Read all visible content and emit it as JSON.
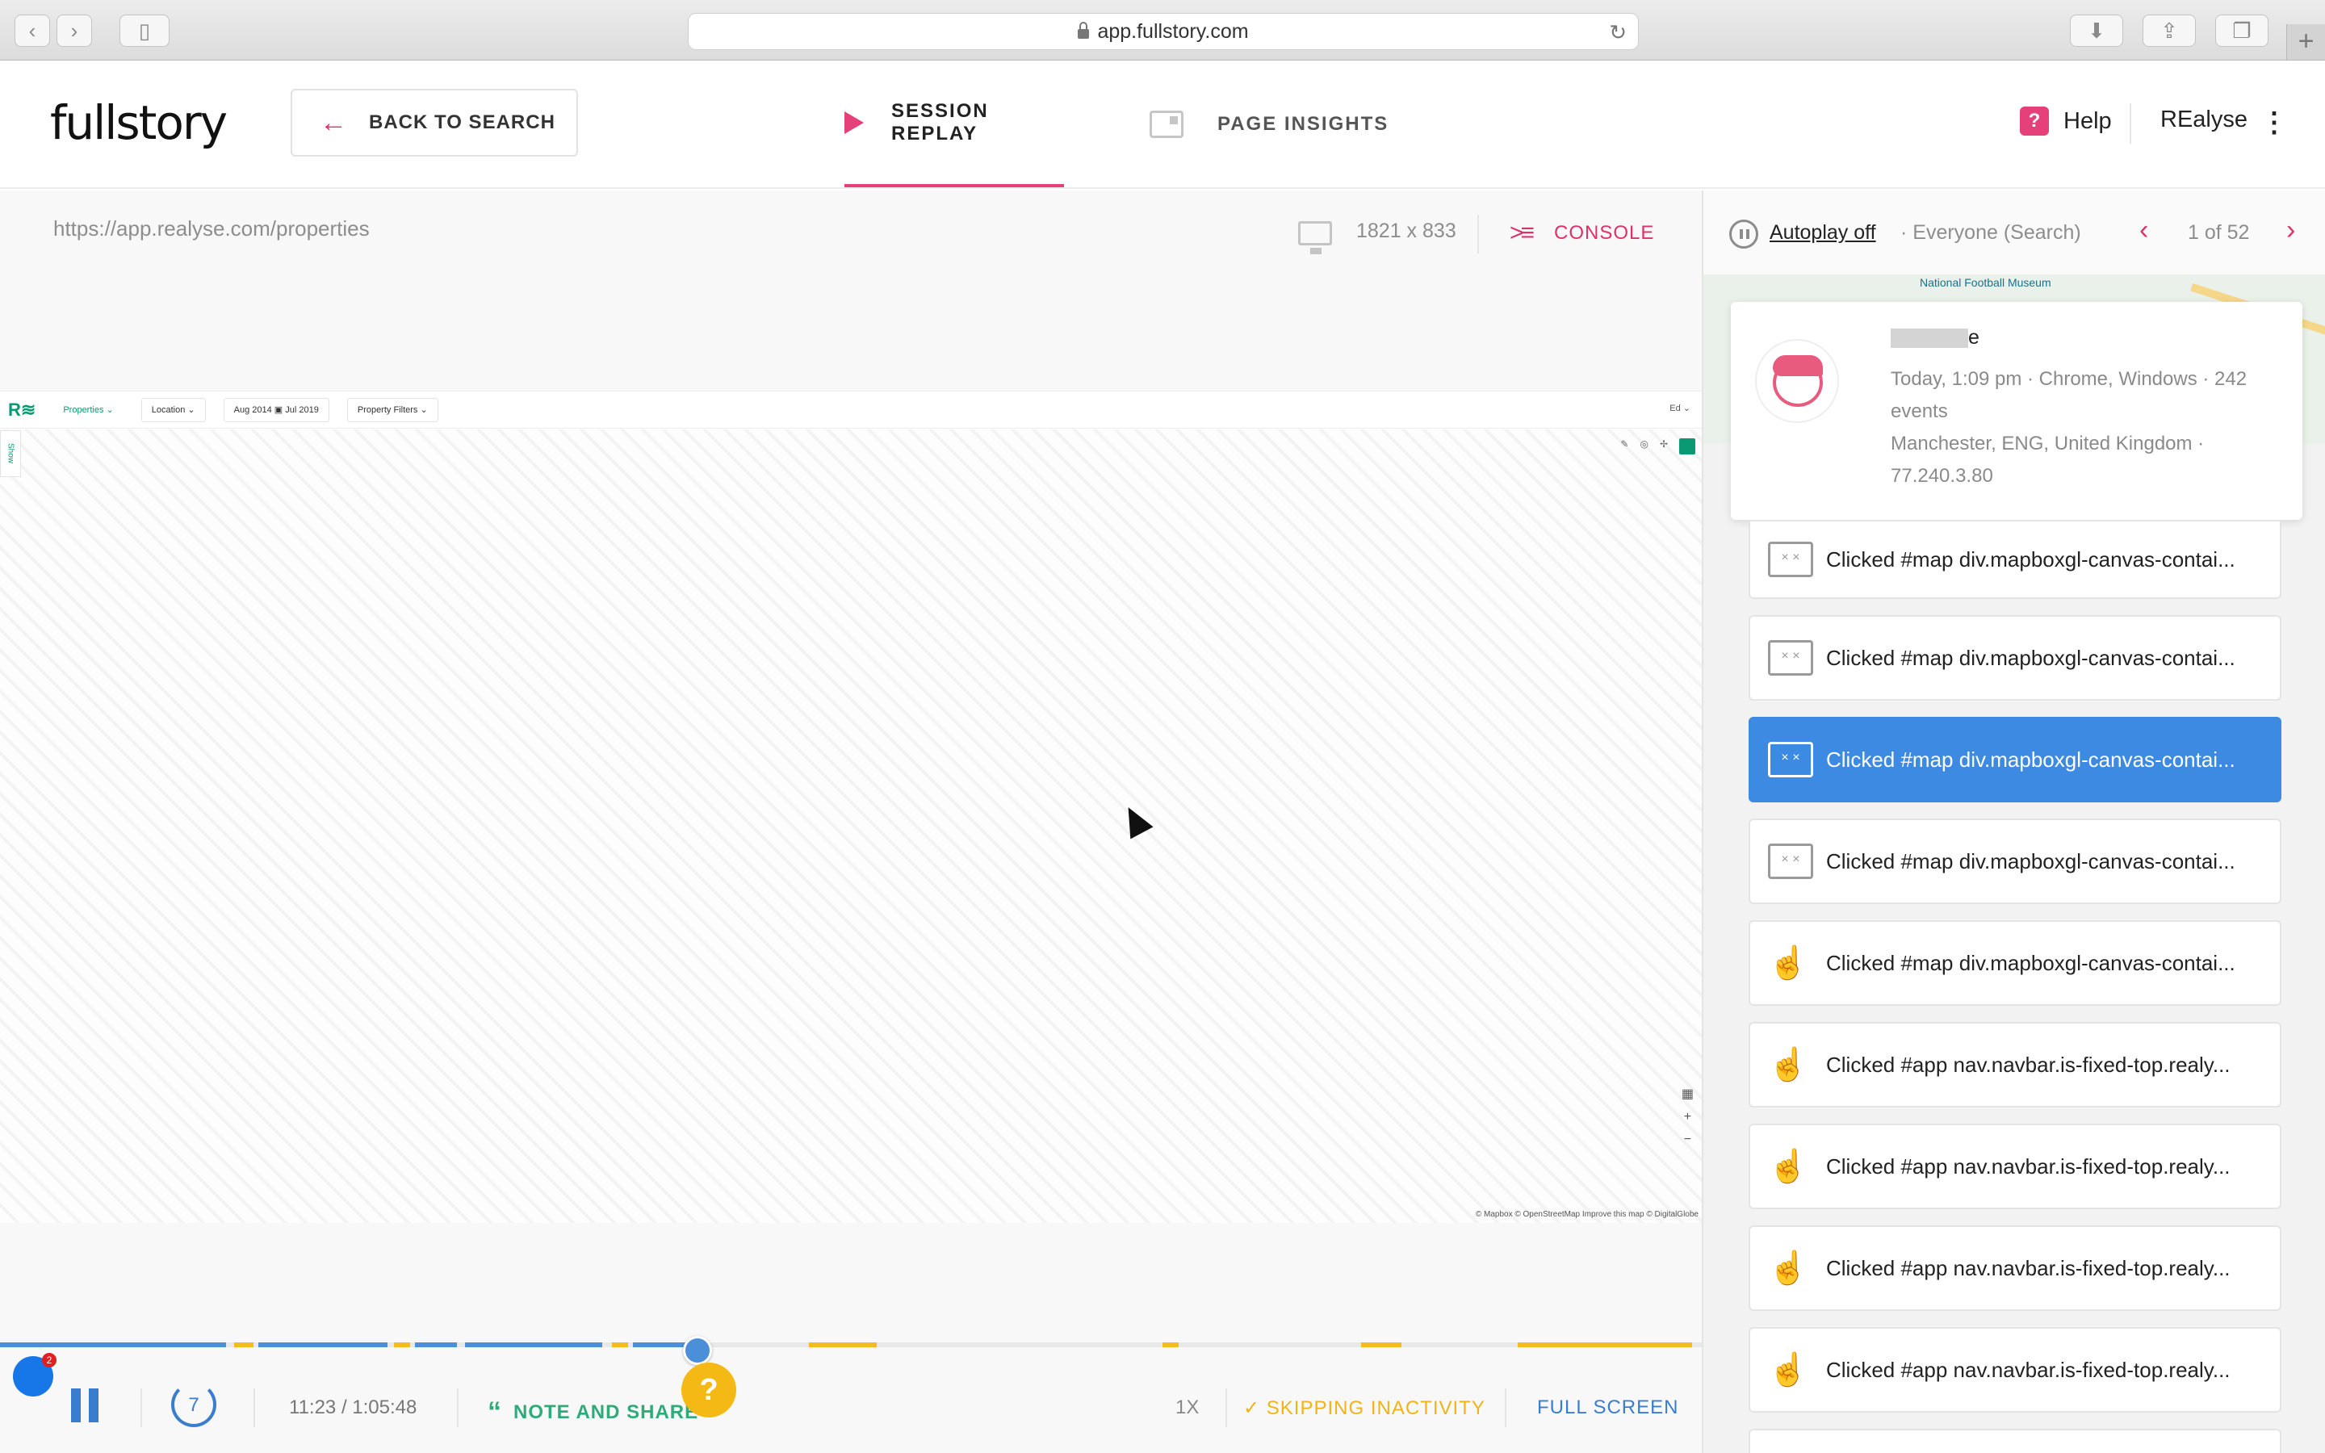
{
  "browser": {
    "url": "app.fullstory.com",
    "back_icon": "‹",
    "forward_icon": "›",
    "sidebar_icon": "▯",
    "download_icon": "⬇",
    "share_icon": "⇪",
    "tabs_icon": "❐",
    "new_tab_icon": "+"
  },
  "header": {
    "logo": "fullstory",
    "back_button": "BACK TO SEARCH",
    "tabs": [
      {
        "label": "SESSION REPLAY",
        "active": true
      },
      {
        "label": "PAGE INSIGHTS",
        "active": false
      }
    ],
    "help": "Help",
    "account": "REalyse",
    "accent_color": "#e6407a"
  },
  "player": {
    "page_url": "https://app.realyse.com/properties",
    "dimensions": "1821 x 833",
    "console_label": "CONSOLE",
    "replayed_app": {
      "nav_item": "Properties ⌄",
      "location_chip": "Location ⌄",
      "date_chip": "Aug 2014 ▣ Jul 2019",
      "filters_chip": "Property Filters ⌄",
      "user_menu": "Ed ⌄",
      "side_tab": "Show",
      "attribution": "© Mapbox © OpenStreetMap Improve this map © DigitalGlobe",
      "chat_badge": "2"
    },
    "controls": {
      "rewind_label": "7",
      "time": "11:23 / 1:05:48",
      "note_share": "NOTE AND SHARE",
      "help_bubble": "?",
      "speed": "1X",
      "skipping": "✓ SKIPPING INACTIVITY",
      "fullscreen": "FULL SCREEN"
    },
    "progress": 0.41
  },
  "sidebar": {
    "autoplay": "Autoplay off",
    "segment": "· Everyone (Search)",
    "counter": "1 of 52",
    "map_label": "National Football Museum",
    "user": {
      "name_suffix": "e",
      "line1": "Today, 1:09 pm · Chrome, Windows · 242 events",
      "line2": "Manchester, ENG, United Kingdom · 77.240.3.80"
    },
    "events": [
      {
        "icon": "window",
        "text": "Clicked #map div.mapboxgl-canvas-contai...",
        "active": false
      },
      {
        "icon": "window",
        "text": "Clicked #map div.mapboxgl-canvas-contai...",
        "active": false
      },
      {
        "icon": "window",
        "text": "Clicked #map div.mapboxgl-canvas-contai...",
        "active": true
      },
      {
        "icon": "window",
        "text": "Clicked #map div.mapboxgl-canvas-contai...",
        "active": false
      },
      {
        "icon": "hand",
        "text": "Clicked #map div.mapboxgl-canvas-contai...",
        "active": false
      },
      {
        "icon": "hand",
        "text": "Clicked #app nav.navbar.is-fixed-top.realy...",
        "active": false
      },
      {
        "icon": "hand",
        "text": "Clicked #app nav.navbar.is-fixed-top.realy...",
        "active": false
      },
      {
        "icon": "hand",
        "text": "Clicked #app nav.navbar.is-fixed-top.realy...",
        "active": false
      },
      {
        "icon": "hand",
        "text": "Clicked #app nav.navbar.is-fixed-top.realy...",
        "active": false
      }
    ]
  }
}
